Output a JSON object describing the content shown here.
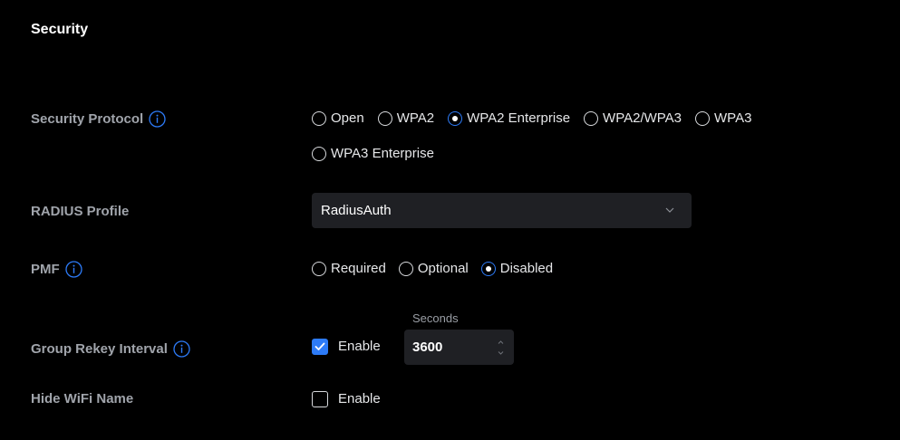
{
  "section": {
    "title": "Security"
  },
  "security_protocol": {
    "label": "Security Protocol",
    "info_icon": "info-circle-icon",
    "options": [
      {
        "label": "Open",
        "selected": false
      },
      {
        "label": "WPA2",
        "selected": false
      },
      {
        "label": "WPA2 Enterprise",
        "selected": true
      },
      {
        "label": "WPA2/WPA3",
        "selected": false
      },
      {
        "label": "WPA3",
        "selected": false
      },
      {
        "label": "WPA3 Enterprise",
        "selected": false
      }
    ]
  },
  "radius_profile": {
    "label": "RADIUS Profile",
    "value": "RadiusAuth",
    "dropdown_icon": "chevron-down-icon"
  },
  "pmf": {
    "label": "PMF",
    "info_icon": "info-circle-icon",
    "options": [
      {
        "label": "Required",
        "selected": false
      },
      {
        "label": "Optional",
        "selected": false
      },
      {
        "label": "Disabled",
        "selected": true
      }
    ]
  },
  "group_rekey": {
    "label": "Group Rekey Interval",
    "info_icon": "info-circle-icon",
    "enable_label": "Enable",
    "enabled": true,
    "unit_caption": "Seconds",
    "value": "3600"
  },
  "hide_wifi": {
    "label": "Hide WiFi Name",
    "enable_label": "Enable",
    "enabled": false
  },
  "colors": {
    "background": "#000000",
    "accent": "#2d7bf7",
    "input_bg": "#1f2024",
    "label": "#a0a4ab",
    "text": "#e6e7e9"
  }
}
